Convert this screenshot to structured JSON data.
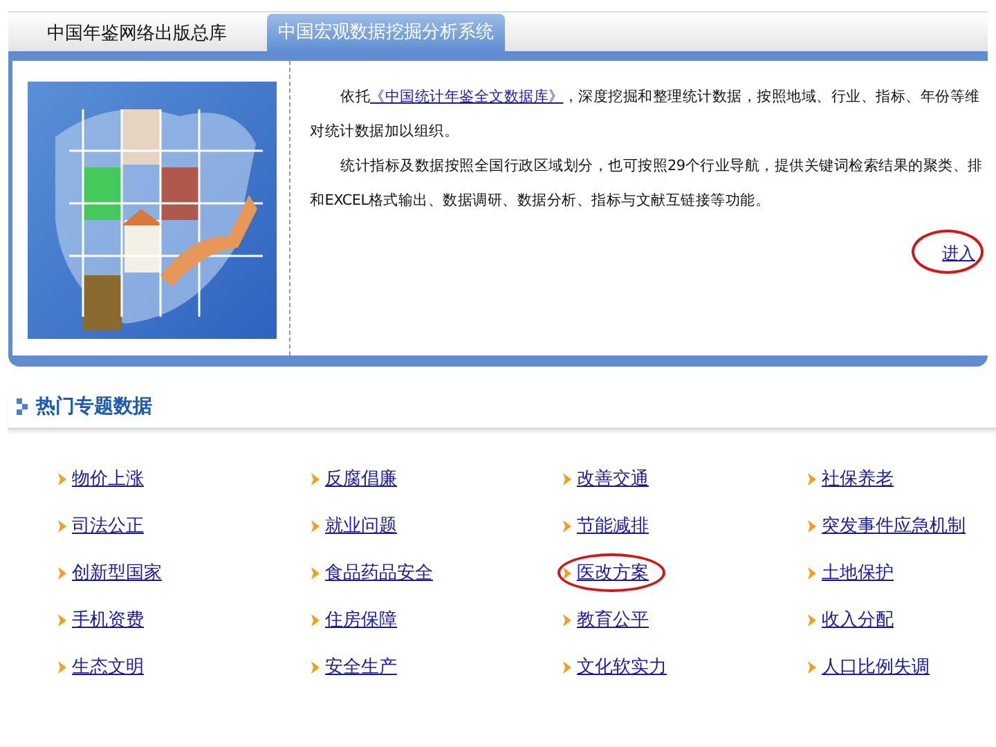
{
  "tabs": [
    {
      "label": "中国年鉴网络出版总库",
      "selected": false
    },
    {
      "label": "中国宏观数据挖掘分析系统",
      "selected": true
    }
  ],
  "intro": {
    "paragraphs": [
      {
        "lines": [
          {
            "before": "依托",
            "link": "《中国统计年鉴全文数据库》",
            "after": "，深度挖掘和整理统计数据，按照地域、行业、指标、年份等维"
          },
          {
            "before": "对统计数据加以组织。"
          }
        ]
      },
      {
        "lines": [
          {
            "before": "统计指标及数据按照全国行政区域划分，也可按照29个行业导航，提供关键词检索结果的聚类、排"
          },
          {
            "before": "和EXCEL格式输出、数据调研、数据分析、指标与文献互链接等功能。"
          }
        ]
      }
    ],
    "enter_link": {
      "label": "进入",
      "highlighted": true
    }
  },
  "section": {
    "title": "热门专题数据"
  },
  "topics": [
    {
      "label": "物价上涨",
      "highlighted": false
    },
    {
      "label": "反腐倡廉",
      "highlighted": false
    },
    {
      "label": "改善交通",
      "highlighted": false
    },
    {
      "label": "社保养老",
      "highlighted": false
    },
    {
      "label": "司法公正",
      "highlighted": false
    },
    {
      "label": "就业问题",
      "highlighted": false
    },
    {
      "label": "节能减排",
      "highlighted": false
    },
    {
      "label": "突发事件应急机制",
      "highlighted": false
    },
    {
      "label": "创新型国家",
      "highlighted": false
    },
    {
      "label": "食品药品安全",
      "highlighted": false
    },
    {
      "label": "医改方案",
      "highlighted": true
    },
    {
      "label": "土地保护",
      "highlighted": false
    },
    {
      "label": "手机资费",
      "highlighted": false
    },
    {
      "label": "住房保障",
      "highlighted": false
    },
    {
      "label": "教育公平",
      "highlighted": false
    },
    {
      "label": "收入分配",
      "highlighted": false
    },
    {
      "label": "生态文明",
      "highlighted": false
    },
    {
      "label": "安全生产",
      "highlighted": false
    },
    {
      "label": "文化软实力",
      "highlighted": false
    },
    {
      "label": "人口比例失调",
      "highlighted": false
    }
  ]
}
